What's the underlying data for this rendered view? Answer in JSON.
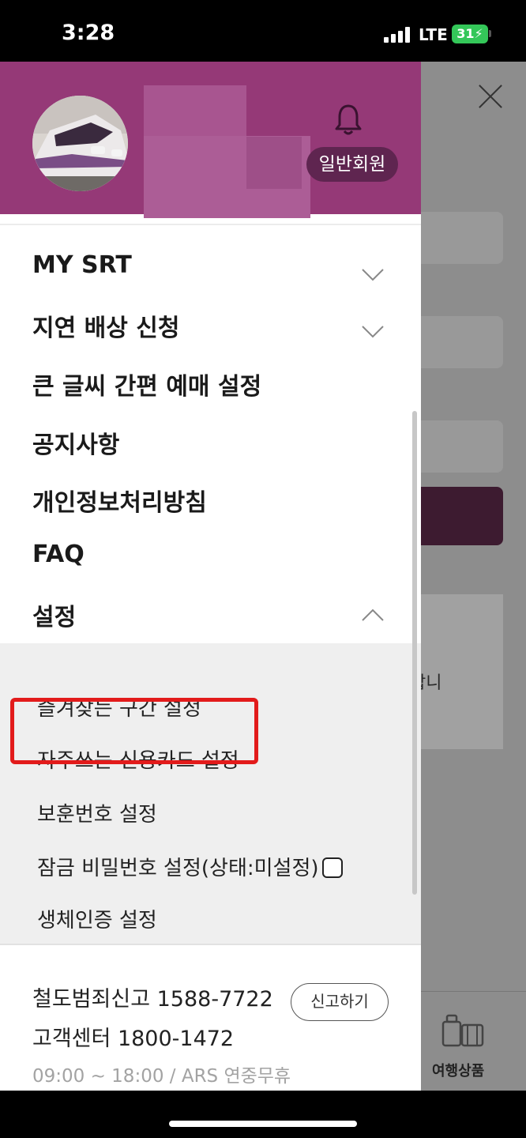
{
  "status_bar": {
    "time": "3:28",
    "network": "LTE",
    "battery": "31",
    "battery_color": "#34c759"
  },
  "header": {
    "member_badge": "일반회원",
    "bg_color": "#953977"
  },
  "menu": {
    "items": [
      {
        "label": "MY SRT",
        "chevron": "down"
      },
      {
        "label": "지연 배상 신청",
        "chevron": "down"
      },
      {
        "label": "큰 글씨 간편 예매 설정"
      },
      {
        "label": "공지사항"
      },
      {
        "label": "개인정보처리방침"
      },
      {
        "label": "FAQ"
      },
      {
        "label": "설정",
        "chevron": "up",
        "expanded": true
      }
    ]
  },
  "settings_submenu": {
    "items": [
      {
        "label": "즐겨찾는 구간 설정"
      },
      {
        "label": "자주쓰는 신용카드 설정",
        "highlighted": true
      },
      {
        "label": "보훈번호 설정"
      },
      {
        "label": "잠금 비밀번호 설정(상태:미설정)",
        "checkbox": false
      },
      {
        "label": "생체인증 설정"
      }
    ],
    "highlight_color": "#e21b1b"
  },
  "footer": {
    "report_line": "철도범죄신고 1588-7722",
    "report_button": "신고하기",
    "customer_center": "고객센터 1800-1472",
    "hours": "09:00 ~ 18:00 / ARS 연중무휴"
  },
  "background_page": {
    "partial_text": "합니",
    "travel_label": "여행상품"
  }
}
